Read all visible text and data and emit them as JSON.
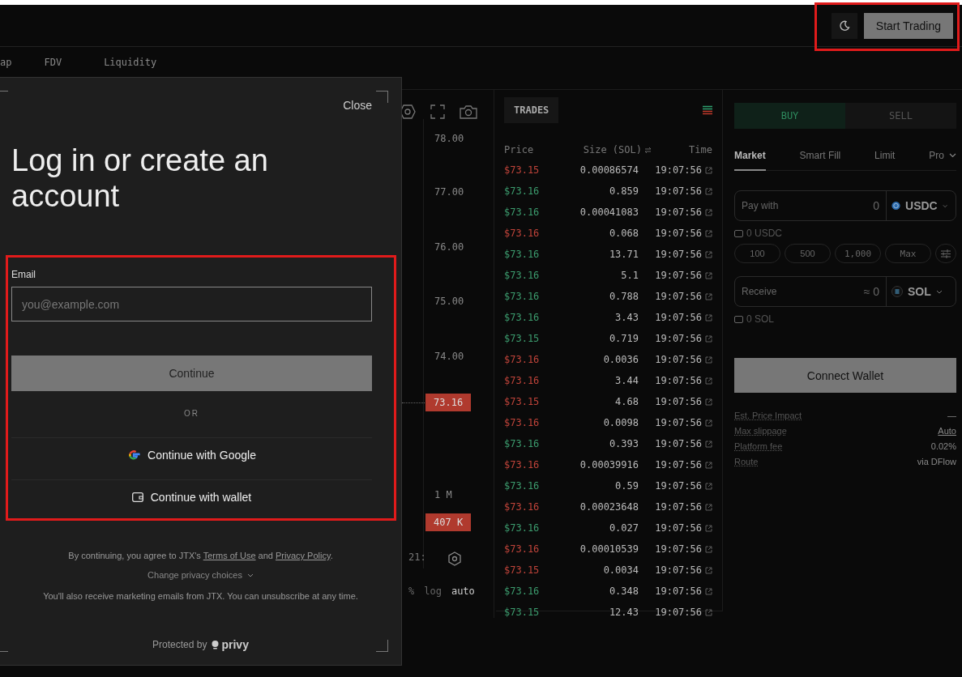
{
  "header": {
    "start_button": "Start Trading"
  },
  "stats": [
    {
      "label": "ap"
    },
    {
      "label": "FDV"
    },
    {
      "label": "Liquidity"
    }
  ],
  "chart": {
    "price_axis": [
      "78.00",
      "77.00",
      "76.00",
      "75.00",
      "74.00"
    ],
    "last_price": "73.16",
    "volume_axis": [
      "1 M"
    ],
    "last_volume": "407 K",
    "time_label": "21:",
    "scale_options": [
      {
        "label": "%",
        "selected": false
      },
      {
        "label": "log",
        "selected": false
      },
      {
        "label": "auto",
        "selected": true
      }
    ]
  },
  "trades": {
    "tab": "TRADES",
    "columns": [
      "Price",
      "Size (SOL)",
      "Time"
    ],
    "rows": [
      {
        "price": "$73.15",
        "size": "0.00086574",
        "time": "19:07:56",
        "color": "#c0443a"
      },
      {
        "price": "$73.16",
        "size": "0.859",
        "time": "19:07:56",
        "color": "#3c9c6e"
      },
      {
        "price": "$73.16",
        "size": "0.00041083",
        "time": "19:07:56",
        "color": "#3c9c6e"
      },
      {
        "price": "$73.16",
        "size": "0.068",
        "time": "19:07:56",
        "color": "#c0443a"
      },
      {
        "price": "$73.16",
        "size": "13.71",
        "time": "19:07:56",
        "color": "#3c9c6e"
      },
      {
        "price": "$73.16",
        "size": "5.1",
        "time": "19:07:56",
        "color": "#3c9c6e"
      },
      {
        "price": "$73.16",
        "size": "0.788",
        "time": "19:07:56",
        "color": "#3c9c6e"
      },
      {
        "price": "$73.16",
        "size": "3.43",
        "time": "19:07:56",
        "color": "#3c9c6e"
      },
      {
        "price": "$73.15",
        "size": "0.719",
        "time": "19:07:56",
        "color": "#3c9c6e"
      },
      {
        "price": "$73.16",
        "size": "0.0036",
        "time": "19:07:56",
        "color": "#c0443a"
      },
      {
        "price": "$73.16",
        "size": "3.44",
        "time": "19:07:56",
        "color": "#c0443a"
      },
      {
        "price": "$73.15",
        "size": "4.68",
        "time": "19:07:56",
        "color": "#c0443a"
      },
      {
        "price": "$73.16",
        "size": "0.0098",
        "time": "19:07:56",
        "color": "#c0443a"
      },
      {
        "price": "$73.16",
        "size": "0.393",
        "time": "19:07:56",
        "color": "#3c9c6e"
      },
      {
        "price": "$73.16",
        "size": "0.00039916",
        "time": "19:07:56",
        "color": "#c0443a"
      },
      {
        "price": "$73.16",
        "size": "0.59",
        "time": "19:07:56",
        "color": "#3c9c6e"
      },
      {
        "price": "$73.16",
        "size": "0.00023648",
        "time": "19:07:56",
        "color": "#c0443a"
      },
      {
        "price": "$73.16",
        "size": "0.027",
        "time": "19:07:56",
        "color": "#3c9c6e"
      },
      {
        "price": "$73.16",
        "size": "0.00010539",
        "time": "19:07:56",
        "color": "#c0443a"
      },
      {
        "price": "$73.15",
        "size": "0.0034",
        "time": "19:07:56",
        "color": "#c0443a"
      },
      {
        "price": "$73.16",
        "size": "0.348",
        "time": "19:07:56",
        "color": "#3c9c6e"
      },
      {
        "price": "$73.15",
        "size": "12.43",
        "time": "19:07:56",
        "color": "#3c9c6e"
      }
    ]
  },
  "order": {
    "sides": [
      {
        "label": "BUY",
        "selected": true
      },
      {
        "label": "SELL",
        "selected": false
      }
    ],
    "order_types": [
      {
        "label": "Market",
        "selected": true,
        "dropdown": false
      },
      {
        "label": "Smart Fill",
        "selected": false,
        "dropdown": false
      },
      {
        "label": "Limit",
        "selected": false,
        "dropdown": false
      },
      {
        "label": "Pro",
        "selected": false,
        "dropdown": true
      }
    ],
    "pay": {
      "label": "Pay with",
      "value": "0",
      "token": "USDC"
    },
    "pay_balance": "0 USDC",
    "quick_amounts": [
      "100",
      "500",
      "1,000",
      "Max"
    ],
    "receive": {
      "label": "Receive",
      "value": "≈ 0",
      "token": "SOL"
    },
    "receive_balance": "0 SOL",
    "connect": "Connect Wallet",
    "details": [
      {
        "label": "Est. Price Impact",
        "value": "—",
        "link": false
      },
      {
        "label": "Max slippage",
        "value": "Auto",
        "link": true
      },
      {
        "label": "Platform fee",
        "value": "0.02%",
        "link": false
      },
      {
        "label": "Route",
        "value": "via DFlow",
        "link": false
      }
    ]
  },
  "modal": {
    "close": "Close",
    "title": "Log in or create an account",
    "email": {
      "label": "Email",
      "placeholder": "you@example.com"
    },
    "continue": "Continue",
    "divider": "OR",
    "providers": [
      {
        "label": "Continue with Google",
        "kind": "google"
      },
      {
        "label": "Continue with wallet",
        "kind": "wallet"
      }
    ],
    "legal": {
      "before": "By continuing, you agree to JTX's ",
      "terms": "Terms of Use",
      "middle": " and ",
      "privacy": "Privacy Policy",
      "after": "."
    },
    "privacy_choices": "Change privacy choices",
    "marketing": "You'll also receive marketing emails from JTX. You can unsubscribe at any time.",
    "protected_by": "Protected by",
    "brand": "privy"
  }
}
